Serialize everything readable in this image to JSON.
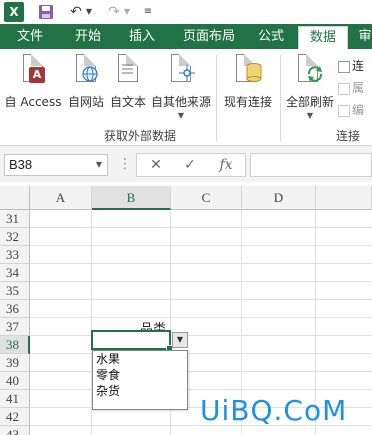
{
  "qat": {
    "app_icon": "excel-icon",
    "app_letter": "X",
    "save_icon": "save-icon",
    "undo_icon": "undo-icon",
    "redo_icon": "redo-icon"
  },
  "tabs": [
    {
      "label": "文件",
      "active": false
    },
    {
      "label": "开始",
      "active": false
    },
    {
      "label": "插入",
      "active": false
    },
    {
      "label": "页面布局",
      "active": false
    },
    {
      "label": "公式",
      "active": false
    },
    {
      "label": "数据",
      "active": true
    },
    {
      "label": "审",
      "active": false
    }
  ],
  "ribbon": {
    "get_external_data": {
      "group_label": "获取外部数据",
      "buttons": [
        {
          "label": "自 Access",
          "icon": "access-db-icon",
          "badge": "A",
          "badge_color": "#a4373a"
        },
        {
          "label": "自网站",
          "icon": "web-globe-icon"
        },
        {
          "label": "自文本",
          "icon": "text-file-icon"
        },
        {
          "label": "自其他来源",
          "icon": "other-sources-icon"
        },
        {
          "label": "现有连接",
          "icon": "existing-connections-icon"
        }
      ]
    },
    "connections": {
      "group_label": "连接",
      "refresh_all": "全部刷新",
      "small_cmds": [
        "连",
        "属",
        "编"
      ]
    }
  },
  "formula_bar": {
    "name_box": "B38",
    "cancel_symbol": "✕",
    "enter_symbol": "✓",
    "fx_symbol": "fx",
    "content": ""
  },
  "grid": {
    "columns": [
      "A",
      "B",
      "C",
      "D"
    ],
    "selected_column": "B",
    "rows": [
      "31",
      "32",
      "33",
      "34",
      "35",
      "36",
      "37",
      "38",
      "39",
      "40",
      "41",
      "42",
      "43"
    ],
    "selected_row": "38",
    "cells": {
      "B37": "品类",
      "B38": ""
    }
  },
  "dropdown": {
    "options": [
      "水果",
      "零食",
      "杂货"
    ]
  },
  "watermark": "UiBQ.CoM",
  "colors": {
    "accent": "#217346",
    "watermark": "#1e90e6"
  }
}
